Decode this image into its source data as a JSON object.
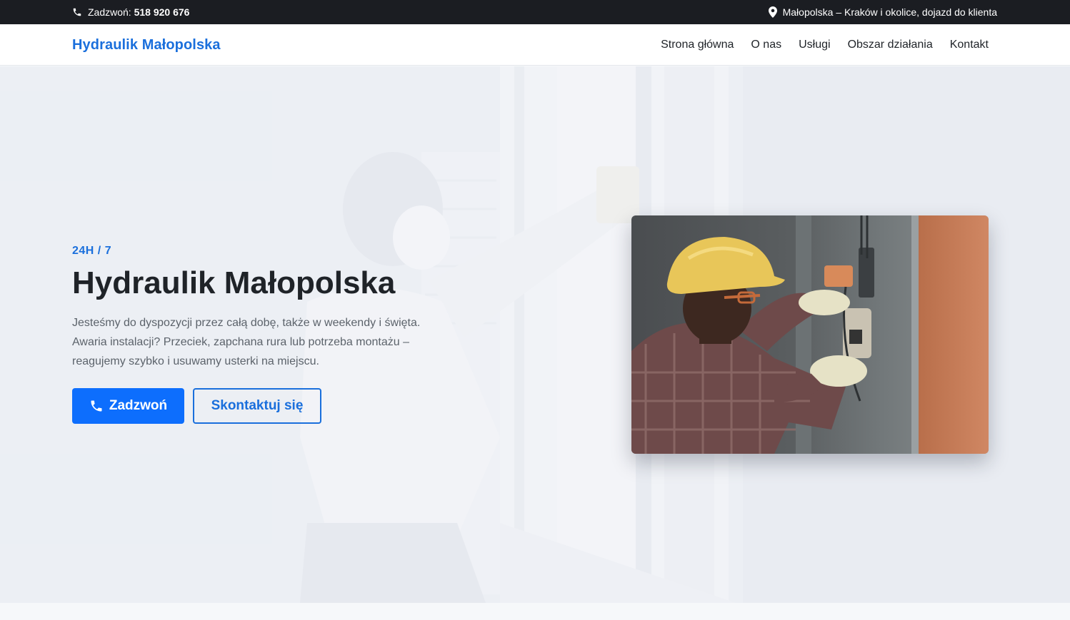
{
  "topbar": {
    "call_label": "Zadzwoń:",
    "phone": "518 920 676",
    "location": "Małopolska – Kraków i okolice, dojazd do klienta"
  },
  "nav": {
    "brand": "Hydraulik Małopolska",
    "links": [
      "Strona główna",
      "O nas",
      "Usługi",
      "Obszar działania",
      "Kontakt"
    ]
  },
  "hero": {
    "eyebrow": "24H / 7",
    "title": "Hydraulik Małopolska",
    "text": "Jesteśmy do dyspozycji przez całą dobę, także w weekendy i święta. Awaria instalacji? Przeciek, zapchana rura lub potrzeba montażu – reagujemy szybko i usuwamy usterki na miejscu.",
    "btn_call": "Zadzwoń",
    "btn_contact": "Skontaktuj się"
  },
  "icons": {
    "phone": "phone-icon",
    "location": "map-pin-icon"
  },
  "colors": {
    "accent": "#1a6fdc",
    "button": "#0d6efd",
    "topbar": "#1b1d22"
  }
}
